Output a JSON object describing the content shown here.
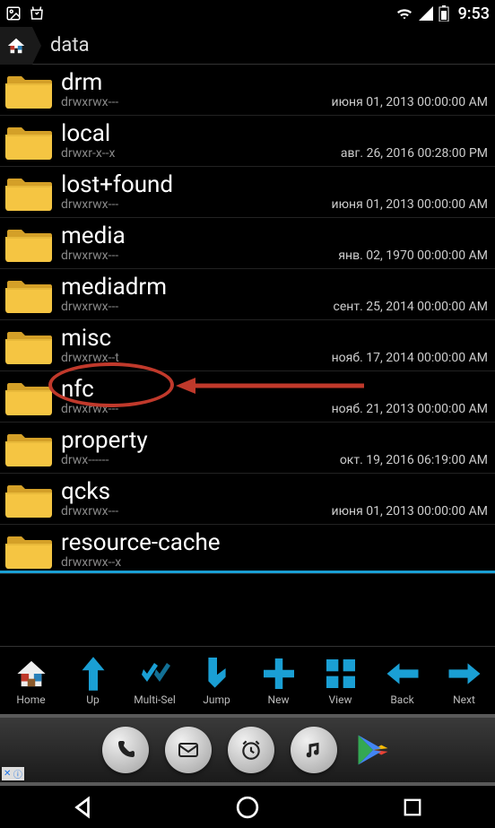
{
  "status": {
    "time": "9:53"
  },
  "breadcrumb": {
    "path": "data"
  },
  "files": [
    {
      "name": "drm",
      "perms": "drwxrwx---",
      "date": "июня 01, 2013 00:00:00 AM"
    },
    {
      "name": "local",
      "perms": "drwxr-x--x",
      "date": "авг. 26, 2016 00:28:00 PM"
    },
    {
      "name": "lost+found",
      "perms": "drwxrwx---",
      "date": "июня 01, 2013 00:00:00 AM"
    },
    {
      "name": "media",
      "perms": "drwxrwx---",
      "date": "янв. 02, 1970 00:00:00 AM"
    },
    {
      "name": "mediadrm",
      "perms": "drwxrwx---",
      "date": "сент. 25, 2014 00:00:00 AM"
    },
    {
      "name": "misc",
      "perms": "drwxrwx--t",
      "date": "нояб. 17, 2014 00:00:00 AM",
      "highlighted": true
    },
    {
      "name": "nfc",
      "perms": "drwxrwx---",
      "date": "нояб. 21, 2013 00:00:00 AM"
    },
    {
      "name": "property",
      "perms": "drwx------",
      "date": "окт. 19, 2016 06:19:00 AM"
    },
    {
      "name": "qcks",
      "perms": "drwxrwx---",
      "date": "июня 01, 2013 00:00:00 AM"
    },
    {
      "name": "resource-cache",
      "perms": "drwxrwx--x",
      "date": ""
    }
  ],
  "toolbar": {
    "home": "Home",
    "up": "Up",
    "multi": "Multi-Sel",
    "jump": "Jump",
    "new": "New",
    "view": "View",
    "back": "Back",
    "next": "Next"
  },
  "ad": {
    "badge_x": "✕",
    "badge_i": "ⓘ"
  }
}
